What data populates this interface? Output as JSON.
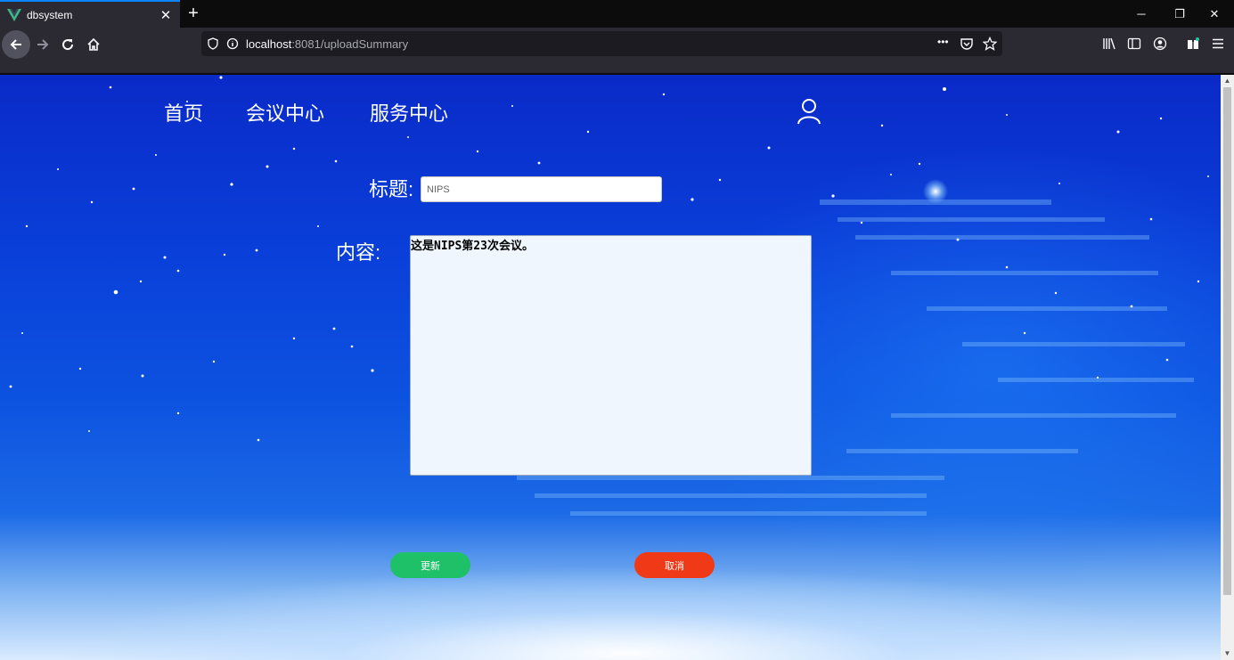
{
  "browser": {
    "tab_title": "dbsystem",
    "new_tab_symbol": "+",
    "close_symbol": "✕",
    "window_controls": {
      "minimize": "─",
      "restore": "❐",
      "close": "✕"
    },
    "url_host": "localhost",
    "url_rest": ":8081/uploadSummary",
    "page_actions": "•••"
  },
  "nav": {
    "items": [
      "首页",
      "会议中心",
      "服务中心"
    ]
  },
  "form": {
    "title_label": "标题:",
    "title_value": "NIPS",
    "content_label": "内容:",
    "content_value": "这是NIPS第23次会议。",
    "update_button": "更新",
    "cancel_button": "取消"
  },
  "colors": {
    "accent_tab": "#0a84ff",
    "update_button": "#1ec068",
    "cancel_button": "#f03a17",
    "vue_logo": "#41b883"
  }
}
